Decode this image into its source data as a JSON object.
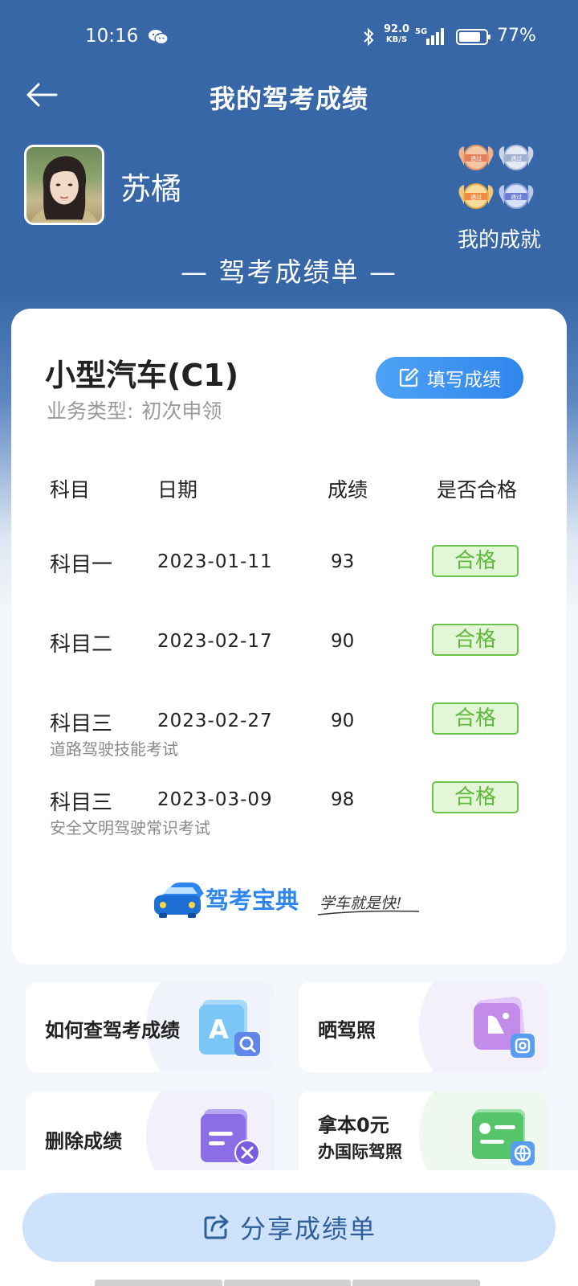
{
  "status_bar": {
    "time": "10:16",
    "net_speed": "92.0",
    "net_unit": "KB/S",
    "network": "5G",
    "battery": "77%"
  },
  "header": {
    "title": "我的驾考成绩",
    "back_icon": "arrow-left-icon"
  },
  "profile": {
    "name": "苏橘",
    "achievement_label": "我的成就",
    "medal_text": "通过"
  },
  "section_title": "— 驾考成绩单 —",
  "card": {
    "vehicle": "小型汽车(C1)",
    "business_label": "业务类型:",
    "business_value": "初次申领",
    "fill_button": "填写成绩",
    "columns": [
      "科目",
      "日期",
      "成绩",
      "是否合格"
    ],
    "rows": [
      {
        "subject": "科目一",
        "note": "",
        "date": "2023-01-11",
        "score": "93",
        "result": "合格"
      },
      {
        "subject": "科目二",
        "note": "",
        "date": "2023-02-17",
        "score": "90",
        "result": "合格"
      },
      {
        "subject": "科目三",
        "note": "道路驾驶技能考试",
        "date": "2023-02-27",
        "score": "90",
        "result": "合格"
      },
      {
        "subject": "科目三",
        "note": "安全文明驾驶常识考试",
        "date": "2023-03-09",
        "score": "98",
        "result": "合格"
      }
    ],
    "brand_name": "驾考宝典",
    "brand_slogan": "学车就是快!"
  },
  "tiles": [
    {
      "label": "如何查驾考成绩",
      "icon": "search-document-icon"
    },
    {
      "label": "晒驾照",
      "icon": "photo-share-icon"
    },
    {
      "label": "删除成绩",
      "icon": "delete-record-icon"
    },
    {
      "label_line1": "拿本0元",
      "label_line2": "办国际驾照",
      "icon": "international-license-icon"
    }
  ],
  "share_button": "分享成绩单",
  "colors": {
    "header_blue": "#3767a7",
    "pass_green": "#5fb83c",
    "button_blue": "#2f86ec"
  }
}
